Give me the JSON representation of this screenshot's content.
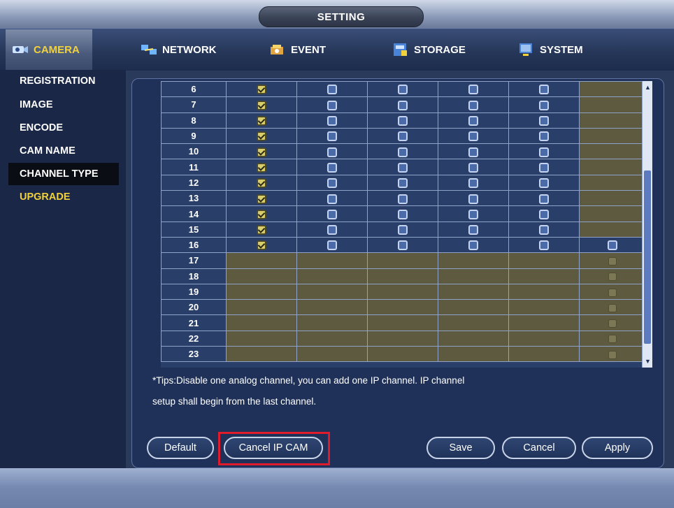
{
  "window": {
    "title": "SETTING"
  },
  "nav": {
    "items": [
      {
        "label": "CAMERA",
        "icon": "camera-icon",
        "active": true
      },
      {
        "label": "NETWORK",
        "icon": "network-icon",
        "active": false
      },
      {
        "label": "EVENT",
        "icon": "event-icon",
        "active": false
      },
      {
        "label": "STORAGE",
        "icon": "storage-icon",
        "active": false
      },
      {
        "label": "SYSTEM",
        "icon": "system-icon",
        "active": false
      }
    ]
  },
  "sidebar": {
    "items": [
      {
        "label": "REGISTRATION"
      },
      {
        "label": "IMAGE"
      },
      {
        "label": "ENCODE"
      },
      {
        "label": "CAM NAME"
      },
      {
        "label": "CHANNEL TYPE",
        "selected": true
      },
      {
        "label": "UPGRADE"
      }
    ]
  },
  "grid": {
    "rows": [
      "6",
      "7",
      "8",
      "9",
      "10",
      "11",
      "12",
      "13",
      "14",
      "15",
      "16",
      "17",
      "18",
      "19",
      "20",
      "21",
      "22",
      "23"
    ],
    "checked_through": "16",
    "ip_from": "17"
  },
  "tips": {
    "line1": "*Tips:Disable one analog channel, you can add one IP channel. IP channel",
    "line2": "setup shall begin from the last channel."
  },
  "buttons": {
    "default": "Default",
    "cancel_ip": "Cancel IP CAM",
    "save": "Save",
    "cancel": "Cancel",
    "apply": "Apply"
  },
  "colors": {
    "accent_yellow": "#f2d23a",
    "highlight_red": "#e01c2c"
  }
}
